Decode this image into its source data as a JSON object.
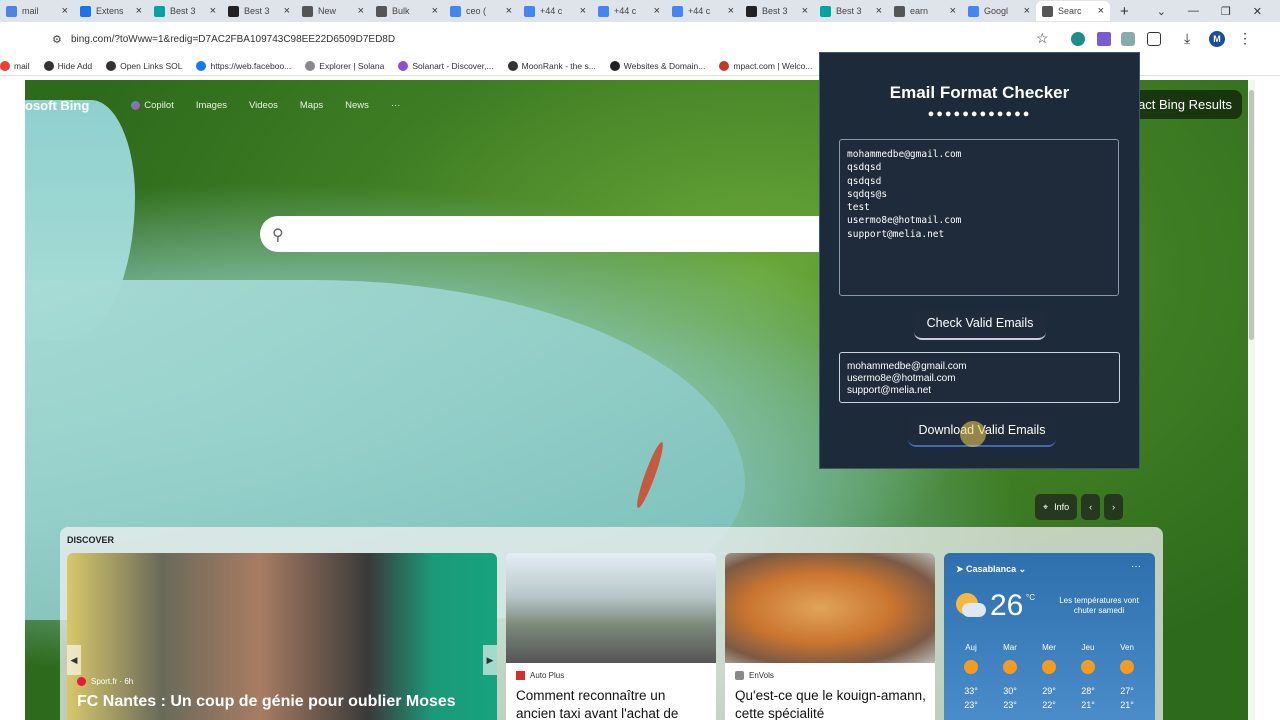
{
  "browser": {
    "tabs": [
      {
        "title": "mail",
        "icon": "tab-favicon",
        "color": "#4a86e8"
      },
      {
        "title": "Extens",
        "icon": "puzzle-icon",
        "color": "#1a73e8"
      },
      {
        "title": "Best 3",
        "icon": "bing-icon",
        "color": "#00a4a6"
      },
      {
        "title": "Best 3",
        "icon": "yp-icon",
        "color": "#222222"
      },
      {
        "title": "New",
        "icon": "chrome-icon",
        "color": "#555555"
      },
      {
        "title": "Bulk",
        "icon": "globe-icon",
        "color": "#555555"
      },
      {
        "title": "ceo (",
        "icon": "google-icon",
        "color": "#4285f4"
      },
      {
        "title": "+44 c",
        "icon": "google-icon",
        "color": "#4285f4"
      },
      {
        "title": "+44 c",
        "icon": "google-icon",
        "color": "#4285f4"
      },
      {
        "title": "+44 c",
        "icon": "google-icon",
        "color": "#4285f4"
      },
      {
        "title": "Best 3",
        "icon": "yp-icon",
        "color": "#222222"
      },
      {
        "title": "Best 3",
        "icon": "bing-icon",
        "color": "#00a4a6"
      },
      {
        "title": "earn",
        "icon": "search-icon",
        "color": "#555555"
      },
      {
        "title": "Googl",
        "icon": "google-icon",
        "color": "#4285f4"
      },
      {
        "title": "Searc",
        "icon": "search-icon",
        "color": "#555555",
        "active": true
      }
    ],
    "url": "bing.com/?toWww=1&redig=D7AC2FBA109743C98EE22D6509D7ED8D",
    "avatar_letter": "M",
    "bookmarks": [
      {
        "label": "mail",
        "color": "#e94235"
      },
      {
        "label": "Hide Add",
        "color": "#333333"
      },
      {
        "label": "Open Links SOL",
        "color": "#333333"
      },
      {
        "label": "https://web.faceboo...",
        "color": "#1877f2"
      },
      {
        "label": "Explorer | Solana",
        "color": "#888888"
      },
      {
        "label": "Solanart - Discover,...",
        "color": "#8a4fd6"
      },
      {
        "label": "MoonRank - the s...",
        "color": "#333333"
      },
      {
        "label": "Websites & Domain...",
        "color": "#222222"
      },
      {
        "label": "mpact.com | Welco...",
        "color": "#c0392b"
      }
    ]
  },
  "bing": {
    "logo": "osoft Bing",
    "nav": [
      "Copilot",
      "Images",
      "Videos",
      "Maps",
      "News",
      "···"
    ],
    "impact_label": "act Bing Results",
    "info_label": "Info",
    "discover_label": "DISCOVER",
    "cards": [
      {
        "source": "Sport.fr · 6h",
        "title": "FC Nantes : Un coup de génie pour oublier Moses"
      },
      {
        "source": "Auto Plus",
        "title": "Comment reconnaître un ancien taxi avant l'achat de"
      },
      {
        "source": "EnVols",
        "title": "Qu'est-ce que le kouign-amann, cette spécialité"
      }
    ],
    "weather": {
      "city": "Casablanca",
      "temp": "26",
      "unit": "°C",
      "note": "Les températures vont chuter samedi",
      "days": [
        {
          "day": "Auj",
          "hi": "33°",
          "lo": "23°"
        },
        {
          "day": "Mar",
          "hi": "30°",
          "lo": "23°"
        },
        {
          "day": "Mer",
          "hi": "29°",
          "lo": "22°"
        },
        {
          "day": "Jeu",
          "hi": "28°",
          "lo": "21°"
        },
        {
          "day": "Ven",
          "hi": "27°",
          "lo": "21°"
        }
      ]
    }
  },
  "extension": {
    "title": "Email Format Checker",
    "dots": "●●●●●●●●●●●●",
    "input_emails": "mohammedbe@gmail.com\nqsdqsd\nqsdqsd\nsqdqs@s\ntest\nusermo8e@hotmail.com\nsupport@melia.net",
    "check_button": "Check Valid Emails",
    "valid_emails": [
      "mohammedbe@gmail.com",
      "usermo8e@hotmail.com",
      "support@melia.net"
    ],
    "download_button": "Download Valid Emails"
  }
}
